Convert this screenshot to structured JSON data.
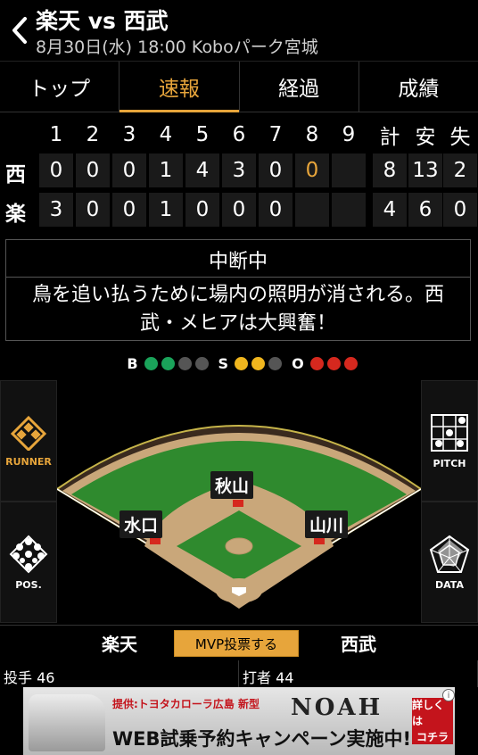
{
  "header": {
    "title": "楽天 vs 西武",
    "subtitle": "8月30日(水) 18:00 Koboパーク宮城"
  },
  "tabs": [
    {
      "label": "トップ",
      "active": false
    },
    {
      "label": "速報",
      "active": true
    },
    {
      "label": "経過",
      "active": false
    },
    {
      "label": "成績",
      "active": false
    }
  ],
  "scoreboard": {
    "innings": [
      "1",
      "2",
      "3",
      "4",
      "5",
      "6",
      "7",
      "8",
      "9"
    ],
    "totals_headers": [
      "計",
      "安",
      "失"
    ],
    "rows": [
      {
        "team": "西",
        "scores": [
          "0",
          "0",
          "0",
          "1",
          "4",
          "3",
          "0",
          "0",
          ""
        ],
        "totals": [
          "8",
          "13",
          "2"
        ],
        "current_inning_index": 7
      },
      {
        "team": "楽",
        "scores": [
          "3",
          "0",
          "0",
          "1",
          "0",
          "0",
          "0",
          "",
          ""
        ],
        "totals": [
          "4",
          "6",
          "0"
        ]
      }
    ]
  },
  "status": {
    "title": "中断中",
    "text": "鳥を追い払うために場内の照明が消される。西武・メヒアは大興奮！"
  },
  "count": {
    "ball_label": "B",
    "strike_label": "S",
    "out_label": "O",
    "balls": 2,
    "strikes": 2,
    "outs": 3,
    "ball_color": "#1aa35a",
    "strike_color": "#f0b61e",
    "out_color": "#d6281e"
  },
  "field": {
    "runners": [
      {
        "name": "秋山",
        "base": "second"
      },
      {
        "name": "水口",
        "base": "third"
      },
      {
        "name": "山川",
        "base": "first"
      }
    ]
  },
  "side_buttons": {
    "runner": "RUNNER",
    "pos": "POS.",
    "pitch": "PITCH",
    "data": "DATA"
  },
  "bottom": {
    "home_tab": "楽天",
    "away_tab": "西武",
    "mvp_label": "MVP投票する",
    "pitcher_label": "投手 46",
    "batter_label": "打者 44"
  },
  "ad": {
    "sponsor": "提供:トヨタカローラ広島 新型",
    "product": "NOAH",
    "headline": "WEB試乗予約キャンペーン実施中!",
    "cta_line1": "詳しくは",
    "cta_line2": "コチラ",
    "info_icon": "i"
  },
  "colors": {
    "accent": "#e7a53b",
    "grass": "#2f8a2e",
    "dirt": "#c9a77a"
  }
}
